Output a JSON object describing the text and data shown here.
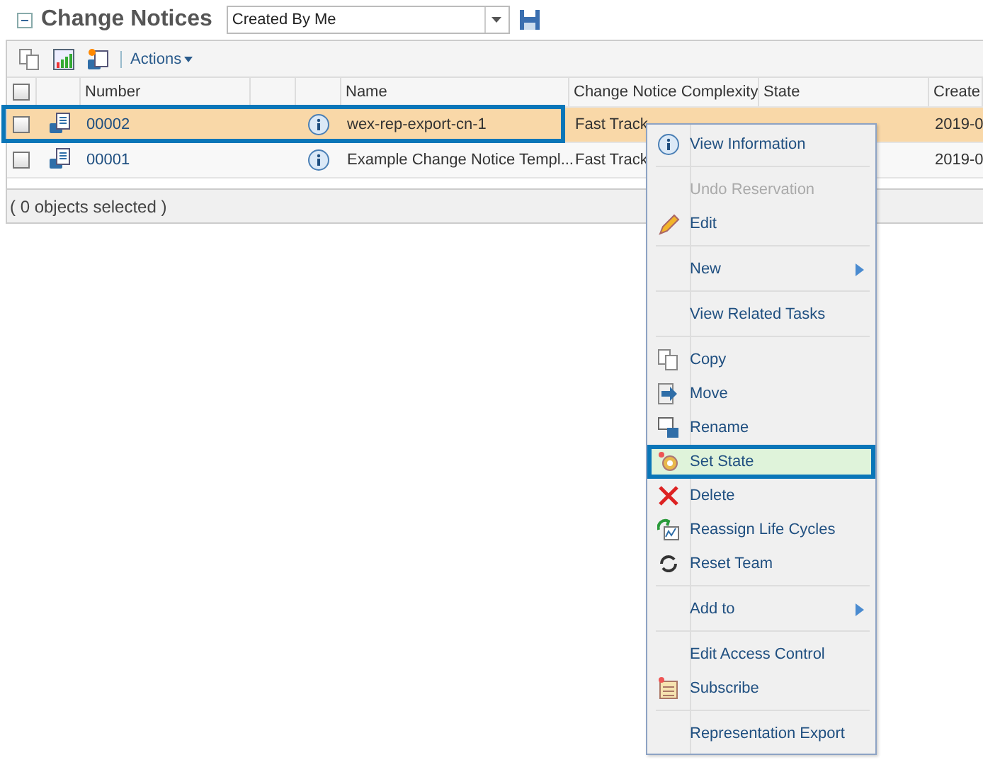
{
  "header": {
    "title": "Change Notices",
    "expanded": true,
    "view": "Created By Me"
  },
  "toolbar": {
    "actions": "Actions"
  },
  "table": {
    "columns": [
      "Number",
      "Name",
      "Change Notice Complexity",
      "State",
      "Create"
    ],
    "select_all_checked": false,
    "rows": [
      {
        "number": "00002",
        "name": "wex-rep-export-cn-1",
        "complexity": "Fast Track",
        "created": "2019-0",
        "selected": true,
        "checked": false
      },
      {
        "number": "00001",
        "name": "Example Change Notice Templ...",
        "complexity": "Fast Track",
        "created": "2019-0",
        "selected": false,
        "checked": false
      }
    ]
  },
  "footer": "( 0 objects selected )",
  "menu": {
    "groups": [
      [
        {
          "label": "View Information",
          "kind": "info",
          "disabled": false,
          "submenu": false,
          "selected": false
        }
      ],
      [
        {
          "label": "Undo Reservation",
          "kind": "none",
          "disabled": true,
          "submenu": false,
          "selected": false
        },
        {
          "label": "Edit",
          "kind": "pencil",
          "disabled": false,
          "submenu": false,
          "selected": false
        }
      ],
      [
        {
          "label": "New",
          "kind": "none",
          "disabled": false,
          "submenu": true,
          "selected": false
        }
      ],
      [
        {
          "label": "View Related Tasks",
          "kind": "none",
          "disabled": false,
          "submenu": false,
          "selected": false
        }
      ],
      [
        {
          "label": "Copy",
          "kind": "copy",
          "disabled": false,
          "submenu": false,
          "selected": false
        },
        {
          "label": "Move",
          "kind": "move",
          "disabled": false,
          "submenu": false,
          "selected": false
        },
        {
          "label": "Rename",
          "kind": "rename",
          "disabled": false,
          "submenu": false,
          "selected": false
        },
        {
          "label": "Set State",
          "kind": "gear",
          "disabled": false,
          "submenu": false,
          "selected": true
        },
        {
          "label": "Delete",
          "kind": "delete",
          "disabled": false,
          "submenu": false,
          "selected": false
        },
        {
          "label": "Reassign Life Cycles",
          "kind": "cycle",
          "disabled": false,
          "submenu": false,
          "selected": false
        },
        {
          "label": "Reset Team",
          "kind": "reset",
          "disabled": false,
          "submenu": false,
          "selected": false
        }
      ],
      [
        {
          "label": "Add to",
          "kind": "none",
          "disabled": false,
          "submenu": true,
          "selected": false
        }
      ],
      [
        {
          "label": "Edit Access Control",
          "kind": "none",
          "disabled": false,
          "submenu": false,
          "selected": false
        },
        {
          "label": "Subscribe",
          "kind": "notes",
          "disabled": false,
          "submenu": false,
          "selected": false
        }
      ],
      [
        {
          "label": "Representation Export",
          "kind": "none",
          "disabled": false,
          "submenu": false,
          "selected": false
        }
      ]
    ]
  }
}
